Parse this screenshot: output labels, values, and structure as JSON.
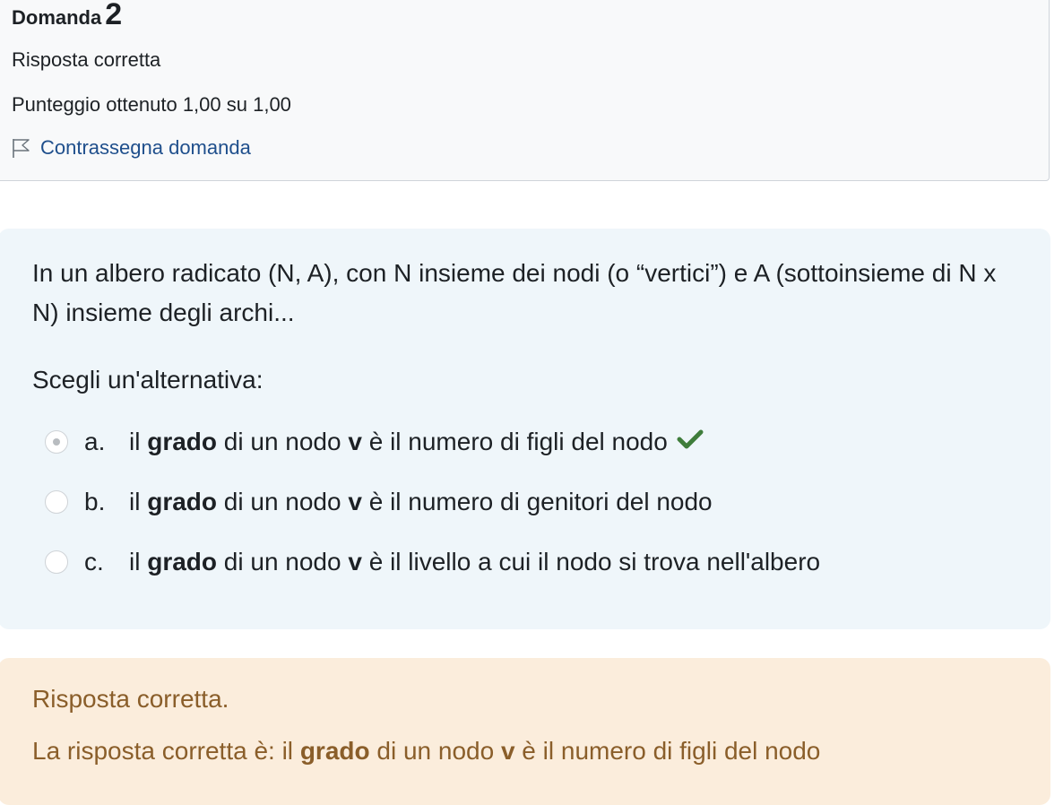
{
  "question": {
    "label": "Domanda",
    "number": "2",
    "state": "Risposta corretta",
    "grade": "Punteggio ottenuto 1,00 su 1,00",
    "flag_label": "Contrassegna domanda"
  },
  "qtext": {
    "text": "In un albero radicato (N, A), con N insieme dei nodi (o “vertici”) e A (sottoinsieme di N x N) insieme degli archi...",
    "prompt": "Scegli un'alternativa:"
  },
  "answers": [
    {
      "letter": "a.",
      "pre": "il ",
      "bold1": "grado",
      "mid": " di un nodo ",
      "bold2": "v",
      "post": " è il numero di figli del nodo",
      "selected": true,
      "correct_mark": true
    },
    {
      "letter": "b.",
      "pre": "il ",
      "bold1": "grado",
      "mid": " di un nodo ",
      "bold2": "v",
      "post": " è il numero di genitori del nodo",
      "selected": false,
      "correct_mark": false
    },
    {
      "letter": "c.",
      "pre": "il ",
      "bold1": "grado",
      "mid": " di un nodo ",
      "bold2": "v",
      "post": " è il livello a cui il nodo si trova nell'albero",
      "selected": false,
      "correct_mark": false
    }
  ],
  "feedback": {
    "status": "Risposta corretta.",
    "pre": "La risposta corretta è: il ",
    "bold1": "grado",
    "mid": " di un nodo ",
    "bold2": "v",
    "post": " è il numero di figli del nodo"
  },
  "colors": {
    "check": "#3f7d3b",
    "link": "#1f4f8c",
    "feedback_text": "#8a5e2a"
  },
  "icons": {
    "flag": "flag-icon",
    "check": "check-icon",
    "radio": "radio-icon"
  }
}
